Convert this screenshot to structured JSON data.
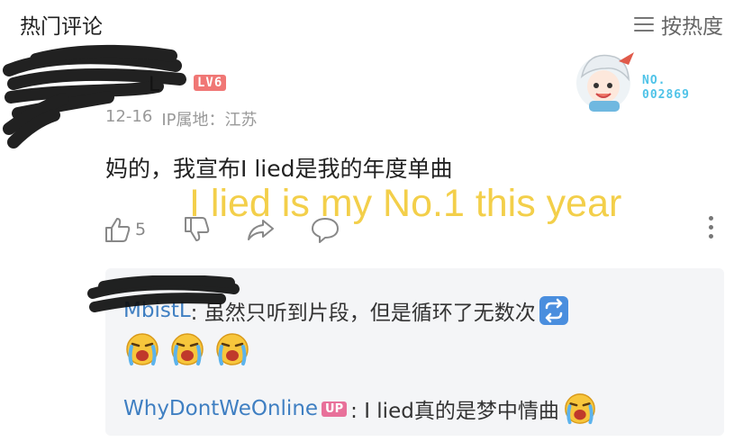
{
  "header": {
    "title": "热门评论",
    "sort_label": "按热度"
  },
  "comment": {
    "user_partial": "L",
    "level": "LV6",
    "date": "12-16",
    "ip_location": "IP属地：江苏",
    "text": "妈的，我宣布I lied是我的年度单曲",
    "like_count": "5",
    "badge_number_line1": "NO.",
    "badge_number_line2": "002869"
  },
  "overlay_caption": "I lied is my No.1 this year",
  "replies": [
    {
      "user": "MbistL",
      "text": ": 虽然只听到片段，但是循环了无数次",
      "emoji_count": 3
    },
    {
      "user": "WhyDontWeOnline",
      "badge": "UP",
      "text": ": I lied真的是梦中情曲"
    }
  ],
  "colors": {
    "accent_blue": "#3f7fc2",
    "level_red": "#f07775",
    "up_pink": "#e8709a",
    "overlay_yellow": "#f3cf4a"
  }
}
